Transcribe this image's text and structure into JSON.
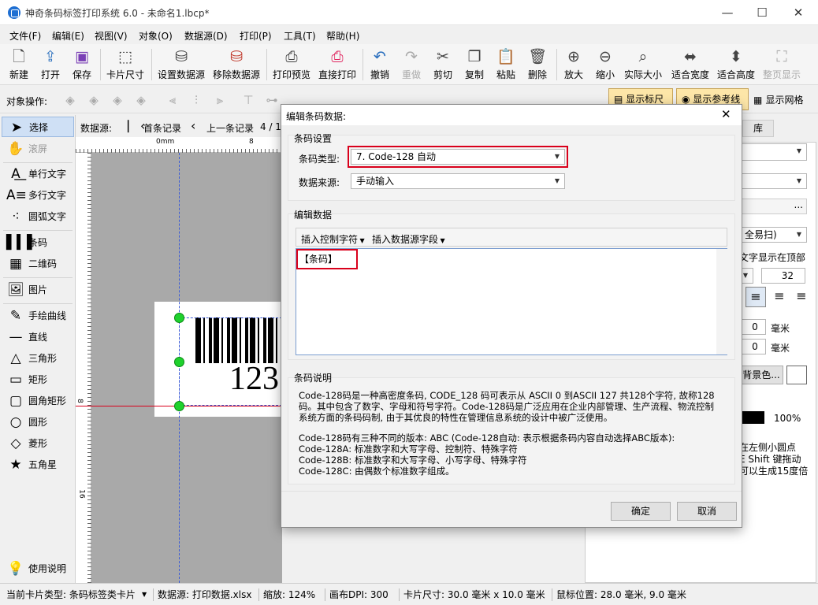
{
  "window": {
    "title": "神奇条码标签打印系统 6.0 - 未命名1.lbcp*",
    "minimize": "—",
    "maximize": "☐",
    "close": "✕"
  },
  "menu": [
    "文件(F)",
    "编辑(E)",
    "视图(V)",
    "对象(O)",
    "数据源(D)",
    "打印(P)",
    "工具(T)",
    "帮助(H)"
  ],
  "toolbar": {
    "new": "新建",
    "open": "打开",
    "save": "保存",
    "card_size": "卡片尺寸",
    "set_datasource": "设置数据源",
    "remove_datasource": "移除数据源",
    "print_preview": "打印预览",
    "direct_print": "直接打印",
    "undo": "撤销",
    "redo": "重做",
    "cut": "剪切",
    "copy": "复制",
    "paste": "粘贴",
    "delete": "删除",
    "zoom_in": "放大",
    "zoom_out": "缩小",
    "actual_size": "实际大小",
    "fit_width": "适合宽度",
    "fit_height": "适合高度",
    "full_page": "整页显示"
  },
  "opsbar": {
    "label": "对象操作:",
    "show_ruler": "显示标尺",
    "show_guides": "显示参考线",
    "show_grid": "显示网格"
  },
  "left_panel": {
    "select": "选择",
    "scroll": "滚屏",
    "single_text": "单行文字",
    "multi_text": "多行文字",
    "arc_text": "圆弧文字",
    "barcode": "条码",
    "qrcode": "二维码",
    "image": "图片",
    "freehand": "手绘曲线",
    "line": "直线",
    "triangle": "三角形",
    "rectangle": "矩形",
    "round_rect": "圆角矩形",
    "circle": "圆形",
    "diamond": "菱形",
    "star": "五角星",
    "help": "使用说明"
  },
  "record_bar": {
    "datasource_label": "数据源:",
    "first": "首条记录",
    "prev": "上一条记录",
    "page": "4 / 1"
  },
  "ruler": {
    "top_marks": [
      "0mm",
      "8"
    ],
    "left_marks": [
      "8",
      "16"
    ]
  },
  "canvas": {
    "barcode_text": "123"
  },
  "right_panel": {
    "tab": "库",
    "scan_mode": "全易扫)",
    "text_top": "文字显示在顶部",
    "font_size": "32",
    "val1": "0",
    "val2": "0",
    "unit1": "毫米",
    "unit2": "毫米",
    "bg_color": "背景色...",
    "opacity": "100%",
    "hint_line1": "在左侧小圆点",
    "hint_line2": "E Shift 键拖动",
    "hint_line3": "可以生成15度倍",
    "ellipsis": "..."
  },
  "dialog": {
    "title": "编辑条码数据:",
    "settings_group": "条码设置",
    "type_label": "条码类型:",
    "type_value": "7. Code-128 自动",
    "source_label": "数据来源:",
    "source_value": "手动输入",
    "edit_group": "编辑数据",
    "insert_ctrl": "插入控制字符",
    "insert_field": "插入数据源字段",
    "data_value": "【条码】",
    "desc_group": "条码说明",
    "desc_p1": "Code-128码是一种高密度条码, CODE_128 码可表示从 ASCII 0 到ASCII 127 共128个字符, 故称128码。其中包含了数字、字母和符号字符。Code-128码是广泛应用在企业内部管理、生产流程、物流控制系统方面的条码码制, 由于其优良的特性在管理信息系统的设计中被广泛使用。",
    "desc_p2": "Code-128码有三种不同的版本: ABC (Code-128自动: 表示根据条码内容自动选择ABC版本):",
    "desc_p3": "Code-128A: 标准数字和大写字母、控制符、特殊字符",
    "desc_p4": "Code-128B: 标准数字和大写字母、小写字母、特殊字符",
    "desc_p5": "Code-128C: 由偶数个标准数字组成。",
    "ok": "确定",
    "cancel": "取消"
  },
  "status": {
    "card_type": "当前卡片类型: 条码标签类卡片",
    "datasource": "数据源: 打印数据.xlsx",
    "zoom": "缩放: 124%",
    "dpi": "画布DPI: 300",
    "card_size": "卡片尺寸: 30.0 毫米 x 10.0 毫米",
    "mouse": "鼠标位置: 28.0 毫米, 9.0 毫米"
  },
  "colors": {
    "highlight_border": "#d9001b",
    "handle_green": "#1fd12d",
    "guide_blue": "#3b5bd6"
  }
}
